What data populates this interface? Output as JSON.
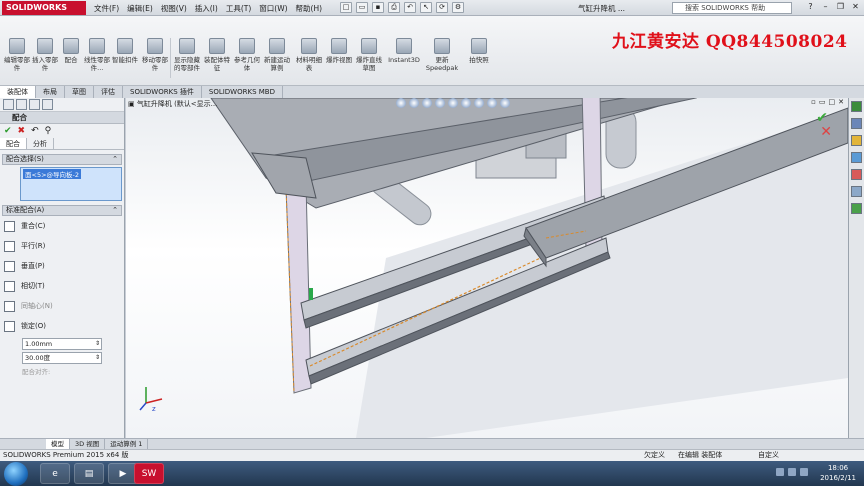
{
  "app": {
    "logo": "SOLIDWORKS",
    "document_title": "气缸升降机 ...",
    "brand_watermark": "九江黄安达 QQ844508024",
    "help_search_placeholder": "搜索 SOLIDWORKS 帮助"
  },
  "menu": [
    "文件(F)",
    "编辑(E)",
    "视图(V)",
    "插入(I)",
    "工具(T)",
    "窗口(W)",
    "帮助(H)"
  ],
  "ribbon": {
    "buttons": [
      {
        "label": "编辑零部件"
      },
      {
        "label": "插入零部件"
      },
      {
        "label": "配合"
      },
      {
        "label": "线性零部件..."
      },
      {
        "label": "智能扣件"
      },
      {
        "label": "移动零部件"
      },
      {
        "label": "显示隐藏的零部件"
      },
      {
        "label": "装配体特征"
      },
      {
        "label": "参考几何体"
      },
      {
        "label": "新建运动算例"
      },
      {
        "label": "材料明细表"
      },
      {
        "label": "爆炸视图"
      },
      {
        "label": "爆炸直线草图"
      },
      {
        "label": "Instant3D"
      },
      {
        "label": "更新 Speedpak"
      },
      {
        "label": "拍快照"
      }
    ]
  },
  "command_tabs": [
    "装配体",
    "布局",
    "草图",
    "评估",
    "SOLIDWORKS 插件",
    "SOLIDWORKS MBD"
  ],
  "property_manager": {
    "title": "配合",
    "sub_tabs": [
      "配合",
      "分析"
    ],
    "selection_group": {
      "header": "配合选择(S)",
      "selected_item": "面<5>@导向板-2"
    },
    "standard_group": {
      "header": "标准配合(A)",
      "mates": [
        {
          "label": "重合(C)",
          "enabled": true
        },
        {
          "label": "平行(R)",
          "enabled": true
        },
        {
          "label": "垂直(P)",
          "enabled": true
        },
        {
          "label": "相切(T)",
          "enabled": true
        },
        {
          "label": "同轴心(N)",
          "enabled": false
        },
        {
          "label": "锁定(O)",
          "enabled": true
        }
      ],
      "distance_value": "1.00mm",
      "angle_value": "30.00度",
      "footer": "配合对齐:"
    }
  },
  "graphics": {
    "tree_flyout": "气缸升降机 (默认<显示...",
    "triad_label": "z"
  },
  "bottom_tabs": [
    "模型",
    "3D 视图",
    "运动算例 1"
  ],
  "status": {
    "app_version": "SOLIDWORKS Premium 2015 x64 版",
    "state": "欠定义",
    "mode": "在编辑 装配体",
    "units": "自定义"
  },
  "taskbar": {
    "time": "18:06",
    "date": "2016/2/11"
  }
}
